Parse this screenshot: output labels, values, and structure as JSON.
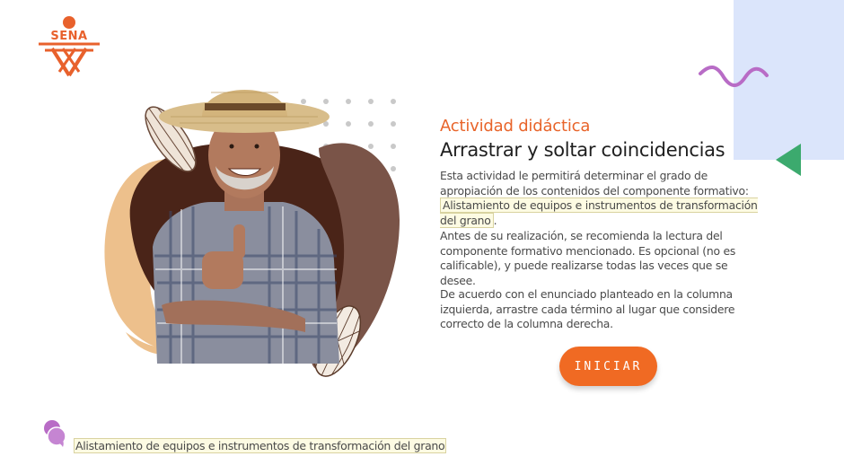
{
  "brand": {
    "logo_text": "SENA",
    "color": "#e8612c"
  },
  "activity": {
    "eyebrow": "Actividad didáctica",
    "title": "Arrastrar y soltar coincidencias",
    "p1_text": "Esta actividad le permitirá determinar el grado de apropiación de los contenidos del componente formativo: ",
    "p1_highlight": "Alistamiento de equipos e instrumentos de transformación del grano",
    "p1_end": ".",
    "p2": "Antes de su realización, se recomienda la lectura del componente formativo mencionado.  Es opcional (no es calificable), y puede realizarse todas las veces que se desee.",
    "p3": "De acuerdo con el enunciado planteado en la columna izquierda, arrastre cada término al lugar que considere correcto de la columna derecha.",
    "start_button": "INICIAR"
  },
  "footer": {
    "label": "Alistamiento de equipos e instrumentos de transformación del grano"
  },
  "icons": {
    "logo": "sena-logo-icon",
    "squiggle": "wave-squiggle-icon",
    "triangle": "triangle-left-icon",
    "bubble": "chat-bubbles-icon"
  },
  "colors": {
    "accent_orange": "#f06a23",
    "light_blue_block": "#dbe5fb",
    "squiggle_purple": "#b86cc6",
    "triangle_green": "#3caa6e",
    "highlight_bg": "#fdfbe3"
  }
}
